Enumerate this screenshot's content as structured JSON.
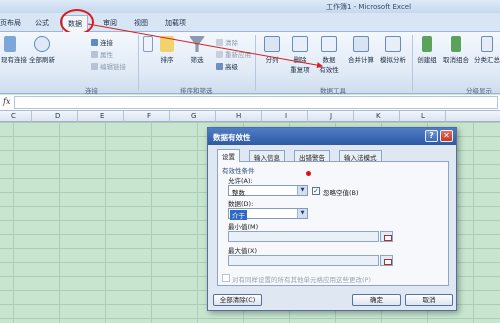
{
  "window": {
    "title": "工作簿1 - Microsoft Excel"
  },
  "tabs": [
    {
      "id": "layout",
      "label": "页布局"
    },
    {
      "id": "formulas",
      "label": "公式"
    },
    {
      "id": "data",
      "label": "数据",
      "active": true
    },
    {
      "id": "review",
      "label": "审阅"
    },
    {
      "id": "view",
      "label": "视图"
    },
    {
      "id": "addins",
      "label": "加载项"
    }
  ],
  "ribbon": {
    "connections": {
      "existing": "现有连接",
      "refresh_all": "全部刷新",
      "connections": "连接",
      "properties": "属性",
      "edit_links": "编辑链接",
      "label": "连接"
    },
    "sort_filter": {
      "sort": "排序",
      "filter": "筛选",
      "clear": "清除",
      "reapply": "重新应用",
      "advanced": "高级",
      "label": "排序和筛选"
    },
    "data_tools": {
      "text_to_columns": "分列",
      "remove_duplicates_1": "删除",
      "remove_duplicates_2": "重复项",
      "data_validation_1": "数据",
      "data_validation_2": "有效性",
      "consolidate": "合并计算",
      "what_if": "模拟分析",
      "label": "数据工具"
    },
    "outline": {
      "group": "创建组",
      "ungroup": "取消组合",
      "subtotal": "分类汇总",
      "label": "分级显示"
    }
  },
  "formula_bar": {
    "fx": "fx",
    "value": ""
  },
  "columns": [
    "C",
    "D",
    "E",
    "F",
    "G",
    "H",
    "I",
    "J",
    "K",
    "L"
  ],
  "dialog": {
    "title": "数据有效性",
    "help": "?",
    "close": "✕",
    "tabs": [
      "设置",
      "输入信息",
      "出错警告",
      "输入法模式"
    ],
    "criteria_heading": "有效性条件",
    "allow_label": "允许(A):",
    "allow_value": "整数",
    "ignore_blank": "忽略空值(B)",
    "data_label": "数据(D):",
    "data_value": "介于",
    "min_label": "最小值(M)",
    "max_label": "最大值(X)",
    "apply_all": "对有同样设置的所有其他单元格应用这些更改(P)",
    "clear_all": "全部清除(C)",
    "ok": "确定",
    "cancel": "取消"
  },
  "colors": {
    "annotation": "#d81e1e",
    "sheet_bg": "#c8e6cf",
    "dialog_title": "#2d5aa3"
  }
}
